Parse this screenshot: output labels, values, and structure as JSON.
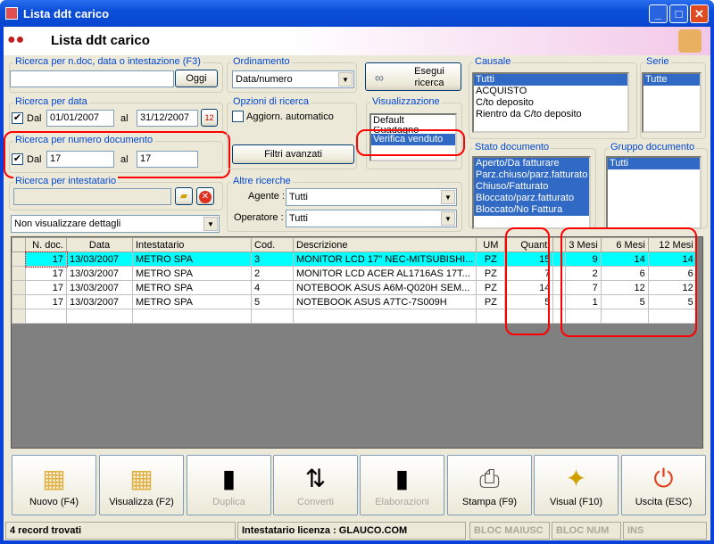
{
  "window": {
    "title": "Lista ddt carico",
    "header": "Lista ddt carico"
  },
  "search_text": {
    "legend": "Ricerca per n.doc, data o intestazione (F3)",
    "value": "",
    "today_btn": "Oggi"
  },
  "search_date": {
    "legend": "Ricerca per data",
    "checked": true,
    "from_label": "Dal",
    "from": "01/01/2007",
    "to_label": "al",
    "to": "31/12/2007"
  },
  "search_number": {
    "legend": "Ricerca per numero documento",
    "checked": true,
    "from_label": "Dal",
    "from": "17",
    "to_label": "al",
    "to": "17"
  },
  "search_owner": {
    "legend": "Ricerca per intestatario",
    "value": ""
  },
  "details_select": "Non visualizzare dettagli",
  "ordering": {
    "legend": "Ordinamento",
    "value": "Data/numero"
  },
  "run_search": "Esegui ricerca",
  "options": {
    "legend": "Opzioni di ricerca",
    "auto_update": "Aggiorn. automatico",
    "advanced": "Filtri avanzati"
  },
  "view": {
    "legend": "Visualizzazione",
    "items": [
      "Default",
      "Guadagno",
      "Verifica venduto"
    ],
    "selected": 2
  },
  "other": {
    "legend": "Altre ricerche",
    "agent_label": "Agente :",
    "agent": "Tutti",
    "operator_label": "Operatore :",
    "operator": "Tutti"
  },
  "causale": {
    "legend": "Causale",
    "items": [
      "Tutti",
      "ACQUISTO",
      "C/to deposito",
      "Rientro da C/to deposito"
    ]
  },
  "serie": {
    "legend": "Serie",
    "items": [
      "Tutte"
    ]
  },
  "stato": {
    "legend": "Stato documento",
    "items": [
      "Aperto/Da fatturare",
      "Parz.chiuso/parz.fatturato",
      "Chiuso/Fatturato",
      "Bloccato/parz.fatturato",
      "Bloccato/No Fattura"
    ]
  },
  "gruppo": {
    "legend": "Gruppo documento",
    "items": [
      "Tutti"
    ]
  },
  "table": {
    "columns": [
      "N. doc.",
      "Data",
      "Intestatario",
      "Cod.",
      "Descrizione",
      "UM",
      "Quant.",
      "",
      "3 Mesi",
      "6 Mesi",
      "12 Mesi"
    ],
    "rows": [
      [
        "17",
        "13/03/2007",
        "METRO SPA",
        "3",
        "MONITOR LCD 17'' NEC-MITSUBISHI...",
        "PZ",
        "15",
        "",
        "9",
        "14",
        "14"
      ],
      [
        "17",
        "13/03/2007",
        "METRO SPA",
        "2",
        "MONITOR LCD ACER AL1716AS 17T...",
        "PZ",
        "7",
        "",
        "2",
        "6",
        "6"
      ],
      [
        "17",
        "13/03/2007",
        "METRO SPA",
        "4",
        "NOTEBOOK ASUS A6M-Q020H SEM...",
        "PZ",
        "14",
        "",
        "7",
        "12",
        "12"
      ],
      [
        "17",
        "13/03/2007",
        "METRO SPA",
        "5",
        "NOTEBOOK ASUS A7TC-7S009H",
        "PZ",
        "5",
        "",
        "1",
        "5",
        "5"
      ]
    ]
  },
  "buttons": [
    {
      "label": "Nuovo (F4)",
      "icon": "new-icon"
    },
    {
      "label": "Visualizza (F2)",
      "icon": "view-icon"
    },
    {
      "label": "Duplica",
      "icon": "duplicate-icon"
    },
    {
      "label": "Converti",
      "icon": "convert-icon"
    },
    {
      "label": "Elaborazioni",
      "icon": "process-icon"
    },
    {
      "label": "Stampa (F9)",
      "icon": "printer-icon"
    },
    {
      "label": "Visual (F10)",
      "icon": "magic-wand-icon"
    },
    {
      "label": "Uscita (ESC)",
      "icon": "exit-icon"
    }
  ],
  "status": {
    "records": "4 record trovati",
    "license": "Intestatario licenza : GLAUCO.COM",
    "caps": "BLOC MAIUSC",
    "num": "BLOC NUM",
    "ins": "INS"
  }
}
